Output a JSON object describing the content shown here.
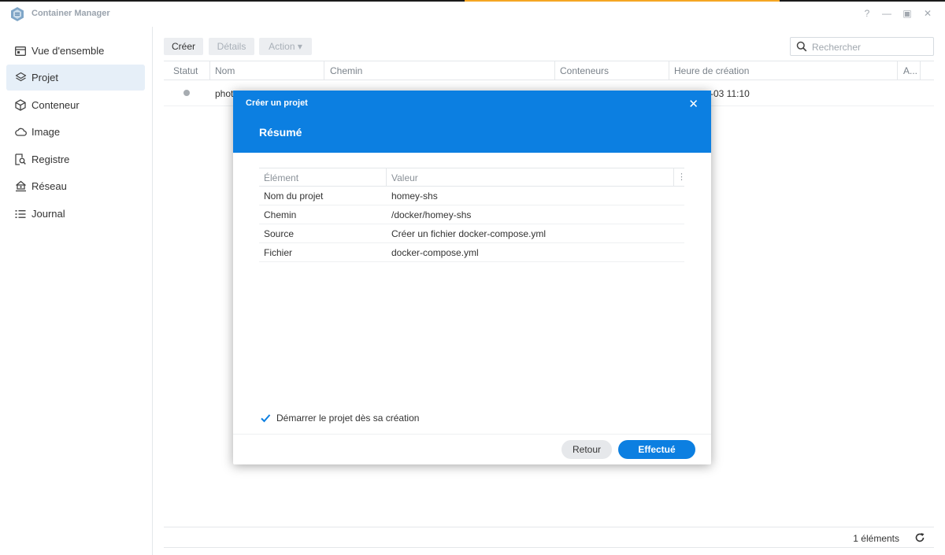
{
  "app": {
    "title": "Container Manager"
  },
  "window_controls": {
    "help": "?",
    "minimize": "—",
    "maximize": "▣",
    "close": "✕"
  },
  "sidebar": {
    "items": [
      {
        "label": "Vue d'ensemble",
        "icon": "overview-icon"
      },
      {
        "label": "Projet",
        "icon": "layers-icon",
        "active": true
      },
      {
        "label": "Conteneur",
        "icon": "cube-icon"
      },
      {
        "label": "Image",
        "icon": "cloud-icon"
      },
      {
        "label": "Registre",
        "icon": "registry-search-icon"
      },
      {
        "label": "Réseau",
        "icon": "network-home-icon"
      },
      {
        "label": "Journal",
        "icon": "list-icon"
      }
    ]
  },
  "toolbar": {
    "create_label": "Créer",
    "details_label": "Détails",
    "action_label": "Action ▾",
    "search_placeholder": "Rechercher"
  },
  "grid": {
    "columns": [
      "Statut",
      "Nom",
      "Chemin",
      "Conteneurs",
      "Heure de création",
      "A..."
    ],
    "rows": [
      {
        "name": "phot",
        "created": "-03 11:10"
      }
    ]
  },
  "footer": {
    "count": "1 éléments"
  },
  "dialog": {
    "title": "Créer un projet",
    "heading": "Résumé",
    "close": "✕",
    "table": {
      "headers": [
        "Élément",
        "Valeur"
      ],
      "rows": [
        {
          "key": "Nom du projet",
          "value": "homey-shs"
        },
        {
          "key": "Chemin",
          "value": "/docker/homey-shs"
        },
        {
          "key": "Source",
          "value": "Créer un fichier docker-compose.yml"
        },
        {
          "key": "Fichier",
          "value": "docker-compose.yml"
        }
      ]
    },
    "checkbox_label": "Démarrer le projet dès sa création",
    "checkbox_checked": true,
    "back_label": "Retour",
    "done_label": "Effectué"
  },
  "colors": {
    "accent": "#0c7fe1",
    "active_nav": "#e6eff8"
  }
}
